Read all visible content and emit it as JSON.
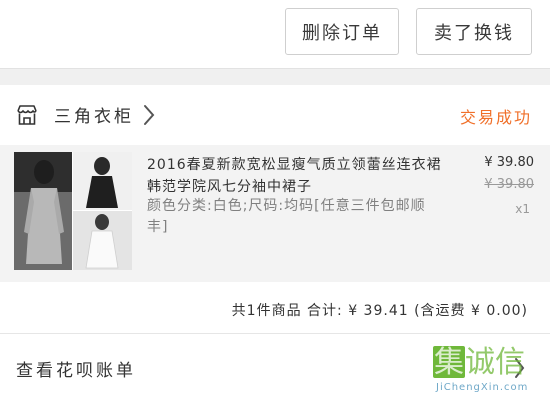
{
  "actions": {
    "delete_label": "删除订单",
    "sell_label": "卖了换钱"
  },
  "shop": {
    "name": "三角衣柜",
    "status": "交易成功",
    "status_color": "#f0702a",
    "icon": "store-icon"
  },
  "product": {
    "title": "2016春夏新款宽松显瘦气质立领蕾丝连衣裙韩范学院风七分袖中裙子",
    "spec": "颜色分类:白色;尺码:均码[任意三件包邮顺丰]",
    "price": "¥ 39.80",
    "original_price": "¥ 39.80",
    "quantity": "x1"
  },
  "summary": {
    "text": "共1件商品   合计: ¥ 39.41 (含运费 ¥ 0.00)"
  },
  "bill": {
    "label": "查看花呗账单"
  },
  "watermark": {
    "chars": "集诚信",
    "url": "JiChengXin.com",
    "color": "#6fb83a"
  }
}
